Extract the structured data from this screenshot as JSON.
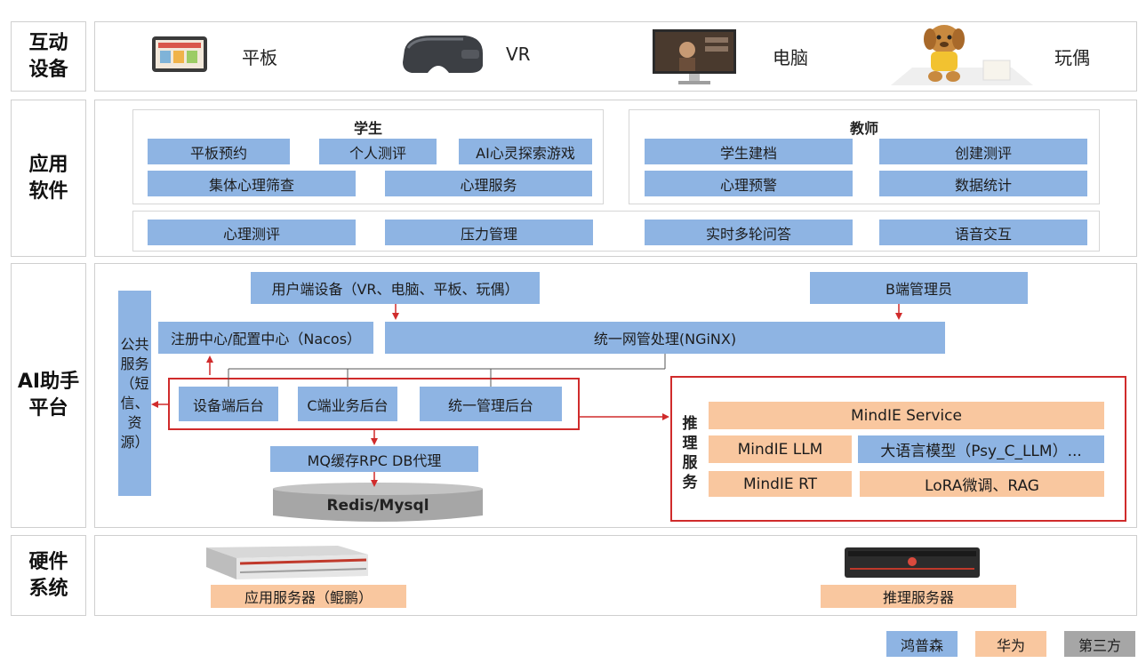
{
  "rows": {
    "devices": "互动\n设备",
    "software": "应用\n软件",
    "platform": "AI助手\n平台",
    "hardware": "硬件\n系统"
  },
  "devices": {
    "tablet": "平板",
    "vr": "VR",
    "pc": "电脑",
    "toy": "玩偶"
  },
  "software": {
    "student_title": "学生",
    "teacher_title": "教师",
    "student_items": [
      "平板预约",
      "个人测评",
      "AI心灵探索游戏",
      "集体心理筛查",
      "心理服务"
    ],
    "teacher_items": [
      "学生建档",
      "创建测评",
      "心理预警",
      "数据统计"
    ],
    "common_items": [
      "心理测评",
      "压力管理",
      "实时多轮问答",
      "语音交互"
    ]
  },
  "platform": {
    "client_devices": "用户端设备（VR、电脑、平板、玩偶）",
    "b_admin": "B端管理员",
    "public_service": "公共服务（短信、资源）",
    "registry": "注册中心/配置中心（Nacos）",
    "gateway": "统一网管处理(NGiNX)",
    "backend_device": "设备端后台",
    "backend_c": "C端业务后台",
    "backend_admin": "统一管理后台",
    "mq": "MQ缓存RPC DB代理",
    "db": "Redis/Mysql",
    "inference_title": "推理\n服务",
    "mindie_service": "MindIE Service",
    "mindie_llm": "MindIE LLM",
    "llm_model": "大语言模型（Psy_C_LLM）...",
    "mindie_rt": "MindIE RT",
    "lora": "LoRA微调、RAG"
  },
  "hardware": {
    "app_server": "应用服务器（鲲鹏）",
    "inference_server": "推理服务器"
  },
  "legend": [
    {
      "label": "鸿普森",
      "color": "#8eb4e3"
    },
    {
      "label": "华为",
      "color": "#f9c79f"
    },
    {
      "label": "第三方",
      "color": "#a6a6a6"
    }
  ],
  "colors": {
    "vendor_blue": "#8eb4e3",
    "vendor_orange": "#f9c79f",
    "vendor_grey": "#a6a6a6",
    "highlight_red": "#d02b2b"
  }
}
